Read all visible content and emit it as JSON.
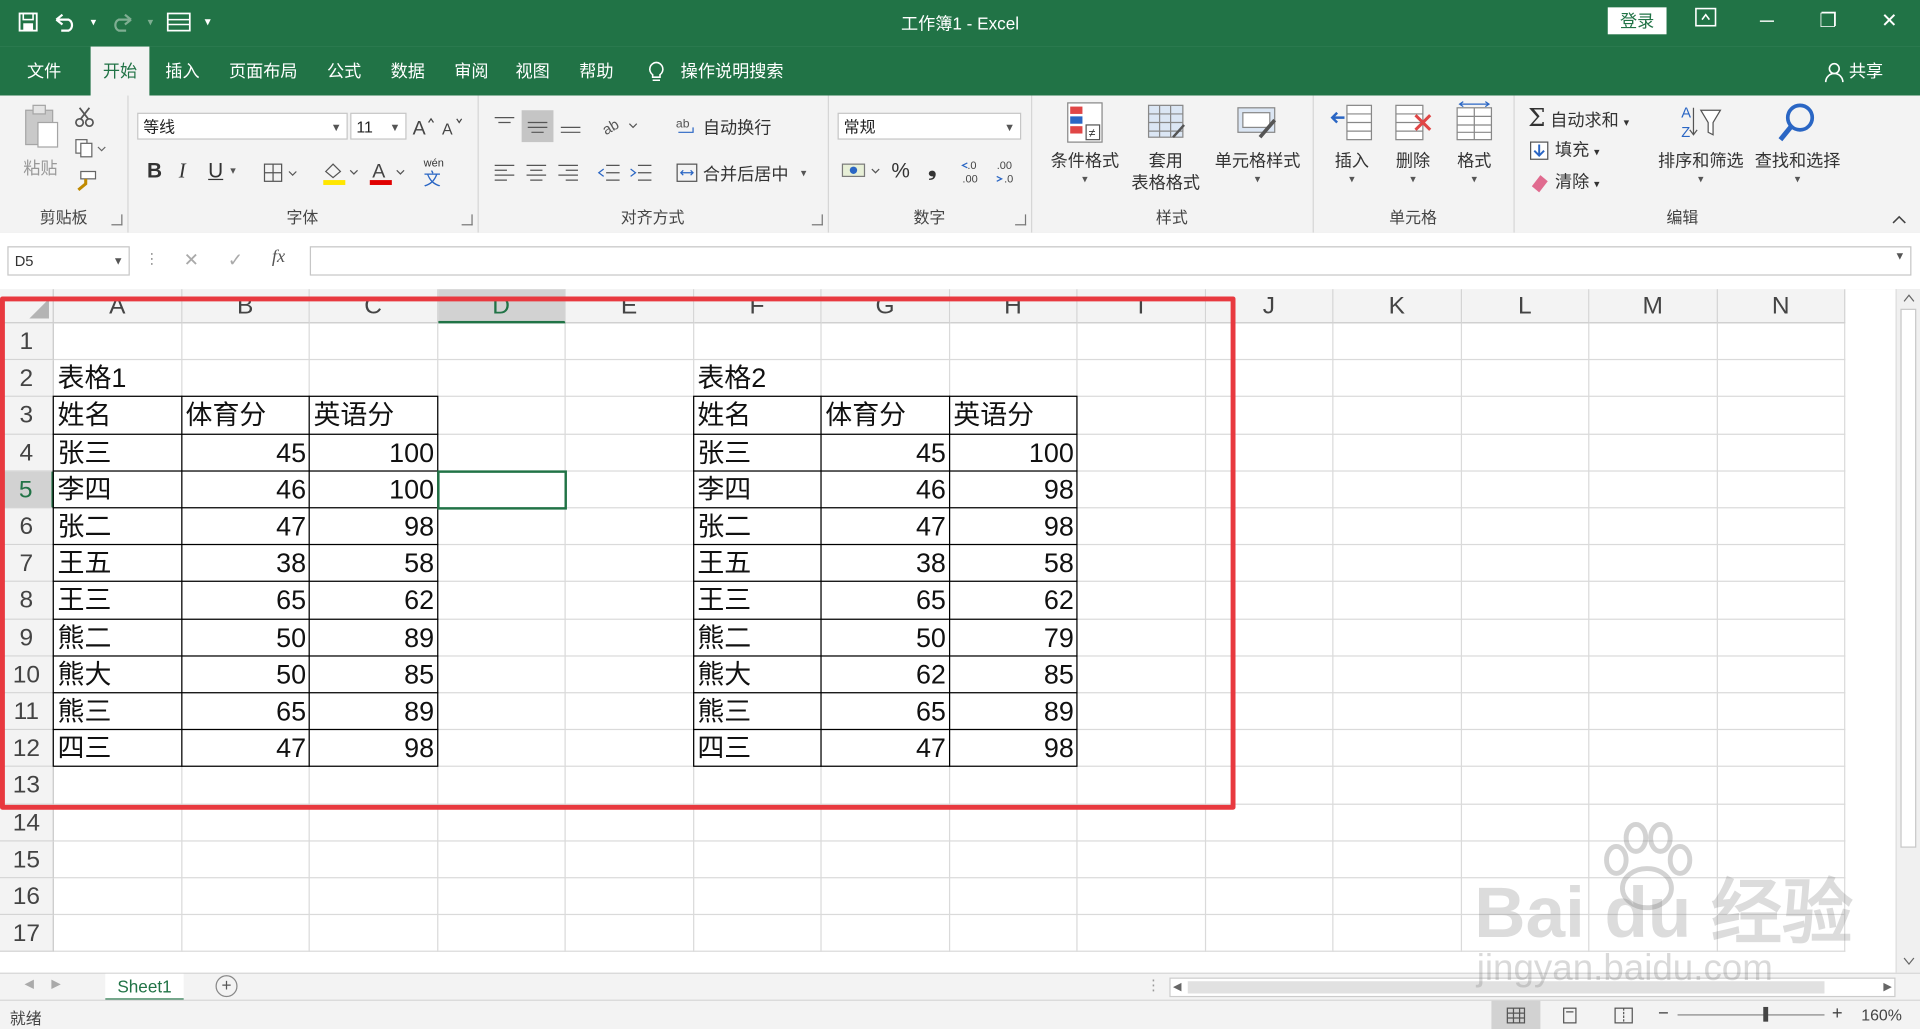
{
  "window": {
    "title": "工作簿1 - Excel",
    "login_label": "登录",
    "minimize": "─",
    "maximize": "❐",
    "close": "✕"
  },
  "tabs": [
    "文件",
    "开始",
    "插入",
    "页面布局",
    "公式",
    "数据",
    "审阅",
    "视图",
    "帮助"
  ],
  "active_tab_index": 1,
  "tell_me": "操作说明搜索",
  "share": "共享",
  "ribbon": {
    "clipboard": {
      "paste": "粘贴",
      "label": "剪贴板"
    },
    "font": {
      "name": "等线",
      "size": "11",
      "bold": "B",
      "italic": "I",
      "underline": "U",
      "label": "字体",
      "wen": "wén",
      "wen_char": "文"
    },
    "alignment": {
      "wrap": "自动换行",
      "merge": "合并后居中",
      "label": "对齐方式"
    },
    "number": {
      "format": "常规",
      "percent": "%",
      "comma": "❟",
      "inc": "←.0\n.00",
      "label": "数字"
    },
    "styles": {
      "conditional": "条件格式",
      "table_line1": "套用",
      "table_line2": "表格格式",
      "cell_styles": "单元格样式",
      "label": "样式"
    },
    "cells": {
      "insert": "插入",
      "delete": "删除",
      "format": "格式",
      "label": "单元格"
    },
    "editing": {
      "autosum": "自动求和",
      "fill": "填充",
      "clear": "清除",
      "sort": "排序和筛选",
      "find": "查找和选择",
      "label": "编辑"
    }
  },
  "formula_bar": {
    "name_box": "D5",
    "fx": "fx",
    "cancel": "✕",
    "enter": "✓",
    "value": ""
  },
  "grid": {
    "columns": [
      "A",
      "B",
      "C",
      "D",
      "E",
      "F",
      "G",
      "H",
      "I",
      "J",
      "K",
      "L",
      "M",
      "N"
    ],
    "rows": [
      "1",
      "2",
      "3",
      "4",
      "5",
      "6",
      "7",
      "8",
      "9",
      "10",
      "11",
      "12",
      "13",
      "14",
      "15",
      "16",
      "17"
    ],
    "selected_column": "D",
    "selected_row": "5",
    "selected_cell": "D5"
  },
  "table1": {
    "title": "表格1",
    "headers": [
      "姓名",
      "体育分",
      "英语分"
    ],
    "rows": [
      [
        "张三",
        "45",
        "100"
      ],
      [
        "李四",
        "46",
        "100"
      ],
      [
        "张二",
        "47",
        "98"
      ],
      [
        "王五",
        "38",
        "58"
      ],
      [
        "王三",
        "65",
        "62"
      ],
      [
        "熊二",
        "50",
        "89"
      ],
      [
        "熊大",
        "50",
        "85"
      ],
      [
        "熊三",
        "65",
        "89"
      ],
      [
        "四三",
        "47",
        "98"
      ]
    ]
  },
  "table2": {
    "title": "表格2",
    "headers": [
      "姓名",
      "体育分",
      "英语分"
    ],
    "rows": [
      [
        "张三",
        "45",
        "100"
      ],
      [
        "李四",
        "46",
        "98"
      ],
      [
        "张二",
        "47",
        "98"
      ],
      [
        "王五",
        "38",
        "58"
      ],
      [
        "王三",
        "65",
        "62"
      ],
      [
        "熊二",
        "50",
        "79"
      ],
      [
        "熊大",
        "62",
        "85"
      ],
      [
        "熊三",
        "65",
        "89"
      ],
      [
        "四三",
        "47",
        "98"
      ]
    ]
  },
  "sheet_tabs": [
    "Sheet1"
  ],
  "add_sheet": "+",
  "status": {
    "ready": "就绪",
    "zoom": "160%",
    "zoom_minus": "−",
    "zoom_plus": "+"
  },
  "watermark": {
    "brand": "Bai  du 经验",
    "url": "jingyan.baidu.com"
  },
  "colors": {
    "excel_green": "#217346",
    "highlight_red": "#e8393f"
  }
}
